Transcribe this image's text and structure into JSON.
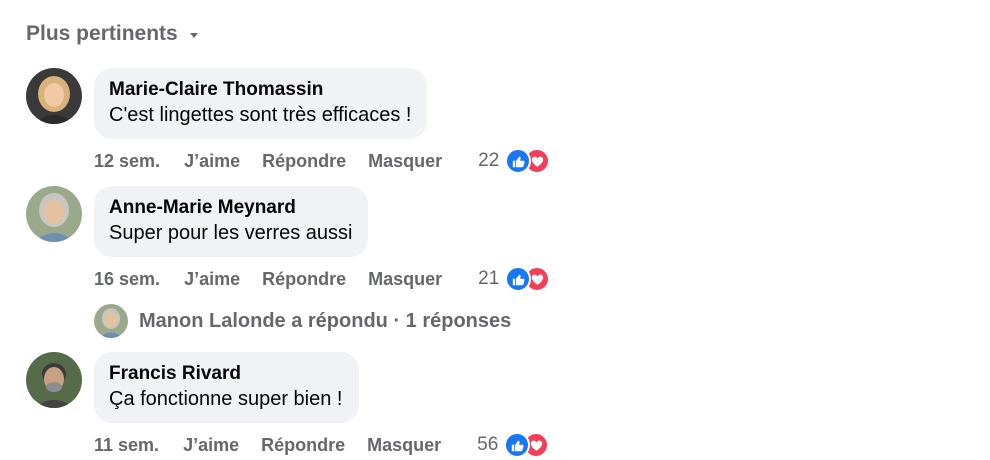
{
  "sort": {
    "label": "Plus pertinents"
  },
  "comments": [
    {
      "author": "Marie-Claire Thomassin",
      "text": "C'est lingettes sont très efficaces !",
      "time": "12 sem.",
      "like_label": "J’aime",
      "reply_label": "Répondre",
      "hide_label": "Masquer",
      "reaction_count": "22"
    },
    {
      "author": "Anne-Marie Meynard",
      "text": "Super pour les verres aussi",
      "time": "16 sem.",
      "like_label": "J’aime",
      "reply_label": "Répondre",
      "hide_label": "Masquer",
      "reaction_count": "21"
    },
    {
      "author": "Francis Rivard",
      "text": "Ça fonctionne super bien !",
      "time": "11 sem.",
      "like_label": "J’aime",
      "reply_label": "Répondre",
      "hide_label": "Masquer",
      "reaction_count": "56"
    }
  ],
  "reply_summary": {
    "text": "Manon Lalonde a répondu · 1 réponses"
  },
  "icons": {
    "like": "thumbs-up-icon",
    "love": "heart-icon",
    "sort": "caret-down-icon"
  },
  "colors": {
    "like": "#1877f2",
    "love": "#f33e58",
    "bubble": "#f0f2f5",
    "secondary_text": "#65676b"
  }
}
